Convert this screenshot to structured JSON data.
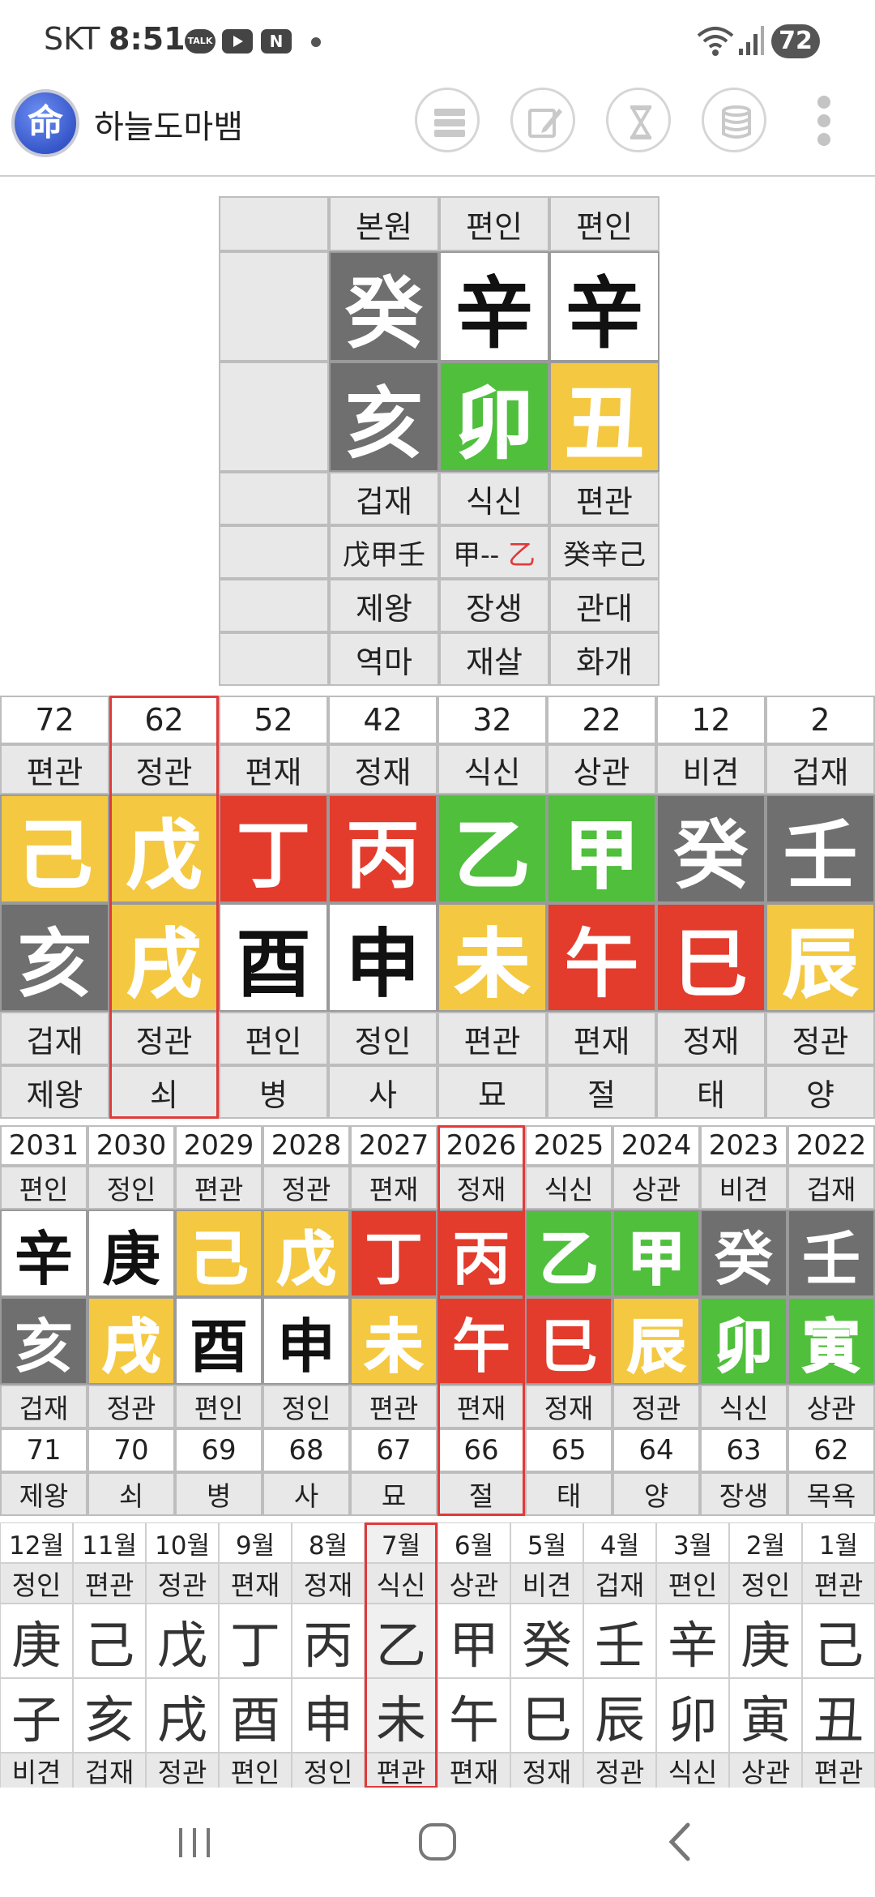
{
  "status_bar": {
    "carrier": "SKT",
    "time": "8:51",
    "notif_icons": [
      "talk-icon",
      "youtube-icon",
      "naver-icon"
    ],
    "talk_text": "TALK",
    "naver_text": "N",
    "battery": "72"
  },
  "app_bar": {
    "logo_char": "命",
    "title": "하늘도마뱀",
    "buttons": [
      "list-icon",
      "edit-icon",
      "hourglass-icon",
      "database-icon",
      "more-icon"
    ]
  },
  "colors": {
    "water": "#6f6f6f",
    "metal": "#ffffff",
    "wood": "#4fbf3c",
    "earth": "#f4c840",
    "fire": "#e33b2c",
    "highlight_red": "#e03a3a",
    "highlight_cell": "#f0f0f0"
  },
  "natal": {
    "header": [
      "",
      "본원",
      "편인",
      "편인"
    ],
    "stems": [
      {
        "char": "",
        "element": "none"
      },
      {
        "char": "癸",
        "element": "water"
      },
      {
        "char": "辛",
        "element": "metal"
      },
      {
        "char": "辛",
        "element": "metal"
      }
    ],
    "branches": [
      {
        "char": "",
        "element": "none"
      },
      {
        "char": "亥",
        "element": "water"
      },
      {
        "char": "卯",
        "element": "wood"
      },
      {
        "char": "丑",
        "element": "earth"
      }
    ],
    "ten_gods": [
      "",
      "겁재",
      "식신",
      "편관"
    ],
    "hidden_stems": [
      [],
      [
        {
          "t": "戊甲壬",
          "red": false
        }
      ],
      [
        {
          "t": "甲-- ",
          "red": false
        },
        {
          "t": "乙",
          "red": true
        }
      ],
      [
        {
          "t": "癸辛己",
          "red": false
        }
      ]
    ],
    "stages": [
      "",
      "제왕",
      "장생",
      "관대"
    ],
    "sinsal": [
      "",
      "역마",
      "재살",
      "화개"
    ]
  },
  "daewoon": {
    "ages": [
      "72",
      "62",
      "52",
      "42",
      "32",
      "22",
      "12",
      "2"
    ],
    "stem_gods": [
      "편관",
      "정관",
      "편재",
      "정재",
      "식신",
      "상관",
      "비견",
      "겁재"
    ],
    "stems": [
      {
        "char": "己",
        "element": "earth"
      },
      {
        "char": "戊",
        "element": "earth"
      },
      {
        "char": "丁",
        "element": "fire"
      },
      {
        "char": "丙",
        "element": "fire"
      },
      {
        "char": "乙",
        "element": "wood"
      },
      {
        "char": "甲",
        "element": "wood"
      },
      {
        "char": "癸",
        "element": "water"
      },
      {
        "char": "壬",
        "element": "water"
      }
    ],
    "branches": [
      {
        "char": "亥",
        "element": "water"
      },
      {
        "char": "戌",
        "element": "earth"
      },
      {
        "char": "酉",
        "element": "metal"
      },
      {
        "char": "申",
        "element": "metal"
      },
      {
        "char": "未",
        "element": "earth"
      },
      {
        "char": "午",
        "element": "fire"
      },
      {
        "char": "巳",
        "element": "fire"
      },
      {
        "char": "辰",
        "element": "earth"
      }
    ],
    "branch_gods": [
      "겁재",
      "정관",
      "편인",
      "정인",
      "편관",
      "편재",
      "정재",
      "정관"
    ],
    "stages": [
      "제왕",
      "쇠",
      "병",
      "사",
      "묘",
      "절",
      "태",
      "양"
    ],
    "selected_index": 1
  },
  "yearly": {
    "years": [
      "2031",
      "2030",
      "2029",
      "2028",
      "2027",
      "2026",
      "2025",
      "2024",
      "2023",
      "2022"
    ],
    "stem_gods": [
      "편인",
      "정인",
      "편관",
      "정관",
      "편재",
      "정재",
      "식신",
      "상관",
      "비견",
      "겁재"
    ],
    "stems": [
      {
        "char": "辛",
        "element": "metal"
      },
      {
        "char": "庚",
        "element": "metal"
      },
      {
        "char": "己",
        "element": "earth"
      },
      {
        "char": "戊",
        "element": "earth"
      },
      {
        "char": "丁",
        "element": "fire"
      },
      {
        "char": "丙",
        "element": "fire"
      },
      {
        "char": "乙",
        "element": "wood"
      },
      {
        "char": "甲",
        "element": "wood"
      },
      {
        "char": "癸",
        "element": "water"
      },
      {
        "char": "壬",
        "element": "water"
      }
    ],
    "branches": [
      {
        "char": "亥",
        "element": "water"
      },
      {
        "char": "戌",
        "element": "earth"
      },
      {
        "char": "酉",
        "element": "metal"
      },
      {
        "char": "申",
        "element": "metal"
      },
      {
        "char": "未",
        "element": "earth"
      },
      {
        "char": "午",
        "element": "fire"
      },
      {
        "char": "巳",
        "element": "fire"
      },
      {
        "char": "辰",
        "element": "earth"
      },
      {
        "char": "卯",
        "element": "wood"
      },
      {
        "char": "寅",
        "element": "wood"
      }
    ],
    "branch_gods": [
      "겁재",
      "정관",
      "편인",
      "정인",
      "편관",
      "편재",
      "정재",
      "정관",
      "식신",
      "상관"
    ],
    "ages": [
      "71",
      "70",
      "69",
      "68",
      "67",
      "66",
      "65",
      "64",
      "63",
      "62"
    ],
    "stages": [
      "제왕",
      "쇠",
      "병",
      "사",
      "묘",
      "절",
      "태",
      "양",
      "장생",
      "목욕"
    ],
    "selected_index": 5
  },
  "monthly": {
    "months": [
      "12월",
      "11월",
      "10월",
      "9월",
      "8월",
      "7월",
      "6월",
      "5월",
      "4월",
      "3월",
      "2월",
      "1월"
    ],
    "stem_gods": [
      "정인",
      "편관",
      "정관",
      "편재",
      "정재",
      "식신",
      "상관",
      "비견",
      "겁재",
      "편인",
      "정인",
      "편관"
    ],
    "stems": [
      "庚",
      "己",
      "戊",
      "丁",
      "丙",
      "乙",
      "甲",
      "癸",
      "壬",
      "辛",
      "庚",
      "己"
    ],
    "branches": [
      "子",
      "亥",
      "戌",
      "酉",
      "申",
      "未",
      "午",
      "巳",
      "辰",
      "卯",
      "寅",
      "丑"
    ],
    "branch_gods": [
      "비견",
      "겁재",
      "정관",
      "편인",
      "정인",
      "편관",
      "편재",
      "정재",
      "정관",
      "식신",
      "상관",
      "편관"
    ],
    "selected_index": 5
  },
  "nav_bar": {
    "buttons": [
      "recent-apps-icon",
      "home-icon",
      "back-icon"
    ]
  }
}
